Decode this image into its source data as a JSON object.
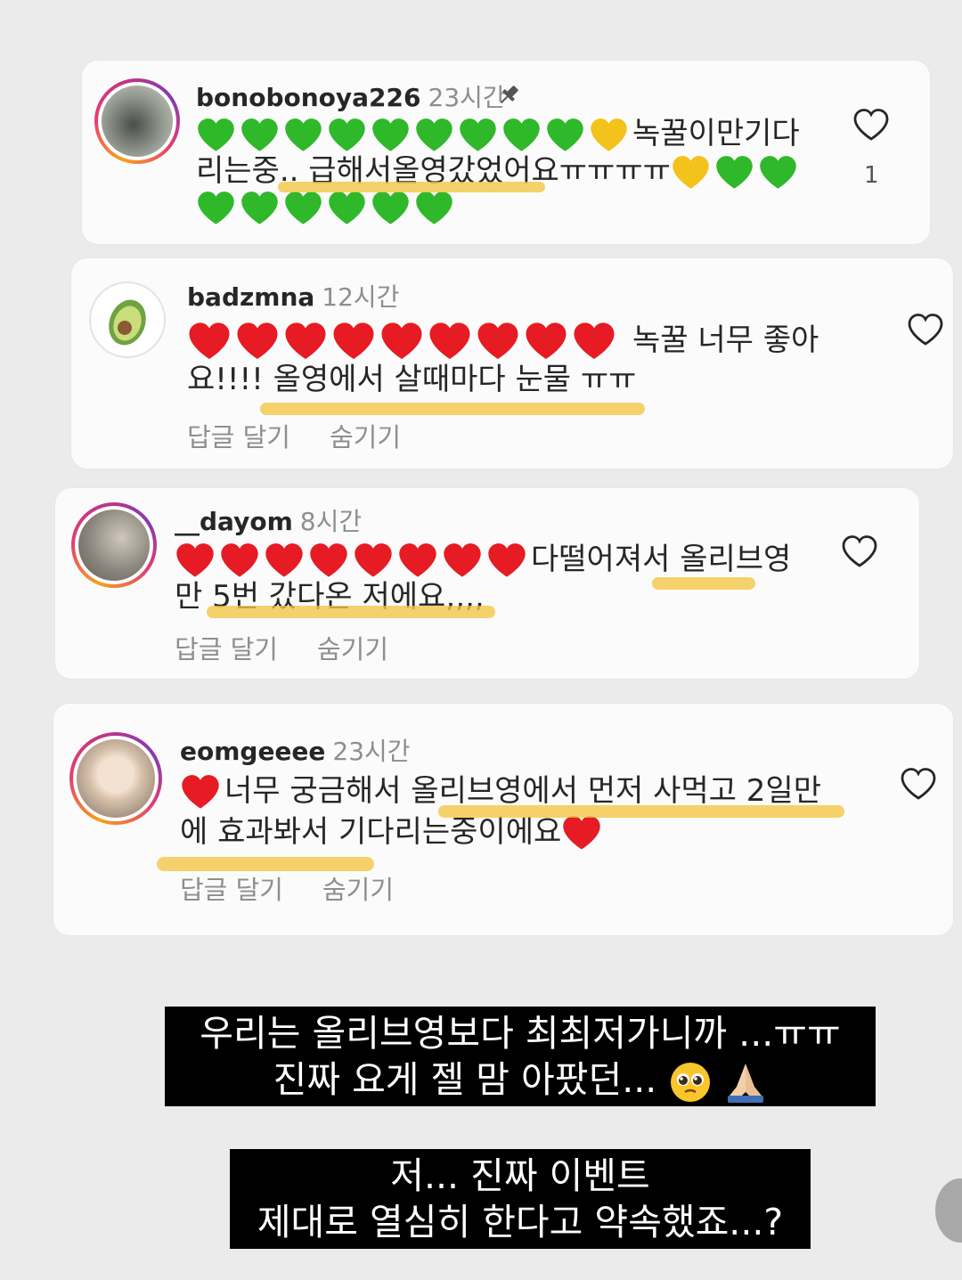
{
  "comments": [
    {
      "username": "bonobonoya226",
      "time": "23시간",
      "pinned": true,
      "line1_text": "녹꿀이만기다",
      "line2_text": "리는중.. 급해서올영갔었어요ㅠㅠㅠㅠ",
      "like_count": "1",
      "avatar_colors": [
        "#6b6f6a",
        "#b3b8ad"
      ]
    },
    {
      "username": "badzmna",
      "time": "12시간",
      "line1_text": "녹꿀 너무 좋아",
      "line2_text": "요!!!! 올영에서 살때마다 눈물 ㅠㅠ",
      "reply_label": "답글 달기",
      "hide_label": "숨기기",
      "avatar_icon": "avocado-icon"
    },
    {
      "username": "__dayom",
      "time": "8시간",
      "line1_text": "다떨어져서 올리브영",
      "line2_text": "만 5번 갔다온 저에요,,,,",
      "reply_label": "답글 달기",
      "hide_label": "숨기기",
      "avatar_colors": [
        "#7a7670",
        "#c9c2b6"
      ]
    },
    {
      "username": "eomgeeee",
      "time": "23시간",
      "line1_text": "너무 궁금해서 올리브영에서 먼저 사먹고 2일만",
      "line2_text": "에 효과봐서 기다리는중이에요",
      "reply_label": "답글 달기",
      "hide_label": "숨기기",
      "avatar_colors": [
        "#d9c3ad",
        "#f1e6da"
      ]
    }
  ],
  "captions": [
    {
      "line1": "우리는 올리브영보다 최최저가니까 ...ㅠㅠ",
      "line2": "진짜 요게 젤 맘 아팠던..."
    },
    {
      "line1": "저... 진짜 이벤트",
      "line2": "제대로 열심히 한다고 약속했죠...?"
    }
  ],
  "colors": {
    "green_heart": "#2fb82a",
    "yellow_heart": "#f3c21b",
    "red_heart": "#e61b23",
    "highlight": "#f4c542"
  }
}
